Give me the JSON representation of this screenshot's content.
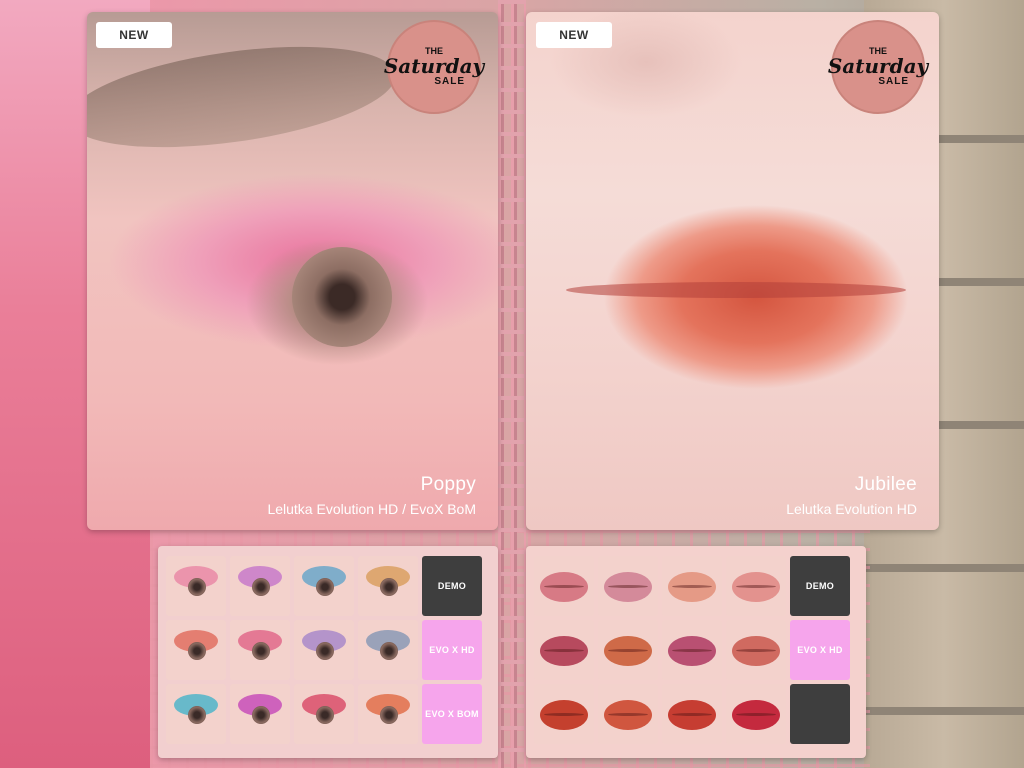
{
  "left_card": {
    "badge": "NEW",
    "logo": {
      "the": "THE",
      "script": "Saturday",
      "sale": "SALE"
    },
    "product_name": "Poppy",
    "product_sub": "Lelutka Evolution HD / EvoX BoM"
  },
  "right_card": {
    "badge": "NEW",
    "logo": {
      "the": "THE",
      "script": "Saturday",
      "sale": "SALE"
    },
    "product_name": "Jubilee",
    "product_sub": "Lelutka Evolution HD"
  },
  "eyeshadow_panel": {
    "swatches": [
      "#e98aa6",
      "#c77ac9",
      "#6aa7c9",
      "#d9a060",
      "#e07060",
      "#e06a8a",
      "#a88ac9",
      "#8a9ab5",
      "#4fb5c9",
      "#c74fb8",
      "#d94f6a",
      "#e0704a"
    ],
    "buttons": {
      "demo": "DEMO",
      "evo_hd": "EVO X HD",
      "evo_bom": "EVO X BOM"
    }
  },
  "lipstick_panel": {
    "swatches": [
      "#d77a85",
      "#d48a9a",
      "#e59a86",
      "#e3928e",
      "#b74a5e",
      "#cf6a48",
      "#b95072",
      "#d06a60",
      "#c4402e",
      "#d0563f",
      "#c63d32",
      "#c42a3e"
    ],
    "buttons": {
      "demo": "DEMO",
      "evo_hd": "EVO X HD"
    }
  }
}
